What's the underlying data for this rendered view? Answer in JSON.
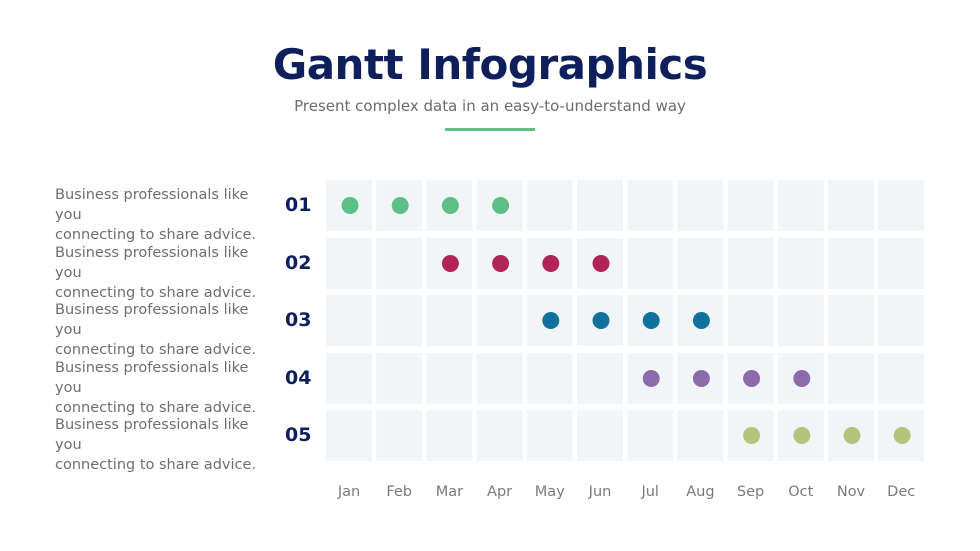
{
  "header": {
    "title": "Gantt Infographics",
    "subtitle": "Present complex data in an easy-to-understand way",
    "accent_color": "#5fbf87"
  },
  "chart_data": {
    "type": "scatter",
    "title": "Gantt Infographics",
    "subtitle": "Present complex data in an easy-to-understand way",
    "xlabel": "",
    "ylabel": "",
    "grid": true,
    "legend": "none",
    "categories": [
      "Jan",
      "Feb",
      "Mar",
      "Apr",
      "May",
      "Jun",
      "Jul",
      "Aug",
      "Sep",
      "Oct",
      "Nov",
      "Dec"
    ],
    "cell_color": "#f1f5f8",
    "series": [
      {
        "name": "01",
        "label": "Business professionals like you connecting to share advice.",
        "label_line1": "Business professionals like you",
        "label_line2": "connecting to share advice.",
        "color": "#5cbf86",
        "months": [
          "Jan",
          "Feb",
          "Mar",
          "Apr"
        ]
      },
      {
        "name": "02",
        "label": "Business professionals like you connecting to share advice.",
        "label_line1": "Business professionals like you",
        "label_line2": "connecting to share advice.",
        "color": "#b22458",
        "months": [
          "Mar",
          "Apr",
          "May",
          "Jun"
        ]
      },
      {
        "name": "03",
        "label": "Business professionals like you connecting to share advice.",
        "label_line1": "Business professionals like you",
        "label_line2": "connecting to share advice.",
        "color": "#10729c",
        "months": [
          "May",
          "Jun",
          "Jul",
          "Aug"
        ]
      },
      {
        "name": "04",
        "label": "Business professionals like you connecting to share advice.",
        "label_line1": "Business professionals like you",
        "label_line2": "connecting to share advice.",
        "color": "#8b6bab",
        "months": [
          "Jul",
          "Aug",
          "Sep",
          "Oct"
        ]
      },
      {
        "name": "05",
        "label": "Business professionals like you connecting to share advice.",
        "label_line1": "Business professionals like you",
        "label_line2": "connecting to share advice.",
        "color": "#b2c57a",
        "months": [
          "Sep",
          "Oct",
          "Nov",
          "Dec"
        ]
      }
    ]
  }
}
